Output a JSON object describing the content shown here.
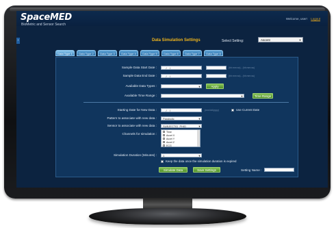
{
  "app": {
    "logo": "SpaceMED",
    "tagline": "BioMetric and Sensor Search",
    "welcome": "Welcome, user!",
    "logout": "Logout"
  },
  "page": {
    "title": "Data Simulation Settings",
    "select_setting_label": "Select Setting:",
    "select_setting_value": "Ascent"
  },
  "tabs": [
    "Data Type 1",
    "Data Type 2",
    "Data Type 3",
    "Data Type 4",
    "Data Type 5",
    "Data Type 6",
    "Data Type 7",
    "Data Type 8"
  ],
  "form": {
    "sample_start_label": "Sample Data Start Date :",
    "sample_end_label": "Sample Data End Date :",
    "date_placeholder": "__/__/__",
    "time_hint": "(hh:mm:ss) - (hh:mm:ss)",
    "available_types_label": "Available Data Types :",
    "apply_button": "Apply",
    "available_time_label": "Available Time Range :",
    "time_button": "Time Range",
    "starting_date_label": "Starting Date for New Data :",
    "starting_date_hint": "(mm/dd/yyyy)",
    "use_current_label": "Use Current Date",
    "pattern_label": "Pattern to associate with new data :",
    "pattern_value": "Parabolic",
    "sensor_label": "Sensor to associate with new data :",
    "sensor_value": "SUBJECTID_PHID",
    "channels_label": "Channels for simulation :",
    "channels": [
      "Time",
      "Accel X",
      "Accel Y",
      "Accel Z",
      "ECG"
    ],
    "duration_label": "Simulation Duration (Minutes) :",
    "duration_value": "1",
    "keep_data_label": "Keep the data once the simulation duration is expired",
    "simulate_button": "Simulate Data",
    "save_button": "Save Settings",
    "setting_name_label": "Setting Name :"
  }
}
